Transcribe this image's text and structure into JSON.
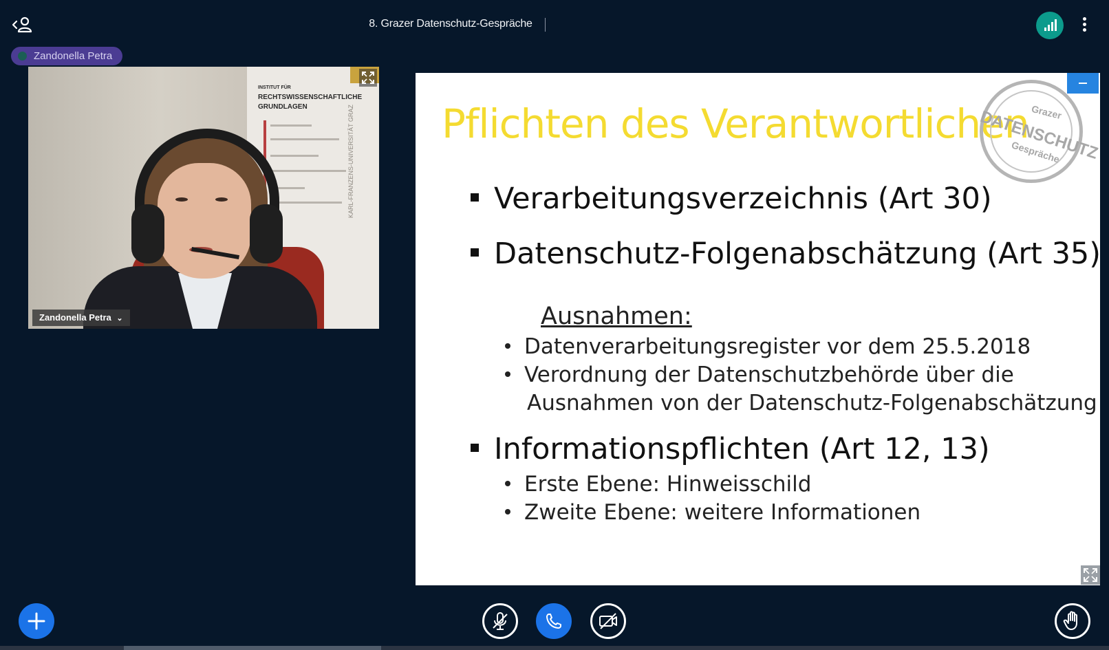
{
  "header": {
    "title": "8. Grazer Datenschutz-Gespräche",
    "users_icon": "user-list-toggle-icon",
    "connection_icon": "connection-status-icon",
    "options_icon": "options-kebab-icon"
  },
  "talking_indicator": {
    "name": "Zandonella Petra"
  },
  "webcam": {
    "user_name": "Zandonella Petra",
    "name_caret": "⌄",
    "poster": {
      "line1": "INSTITUT FÜR",
      "line2": "RECHTSWISSENSCHAFTLICHE",
      "line3": "GRUNDLAGEN",
      "vertical": "KARL-FRANZENS-UNIVERSITÄT GRAZ"
    }
  },
  "slide": {
    "title": "Pflichten des Verantwortlichen",
    "stamp": {
      "top": "Grazer",
      "middle": "DATENSCHUTZ",
      "bottom": "Gespräche"
    },
    "bullets": [
      "Verarbeitungsverzeichnis (Art 30)",
      "Datenschutz-Folgenabschätzung (Art 35)",
      "Informationspflichten (Art 12, 13)"
    ],
    "exceptions_heading": "Ausnahmen:",
    "exceptions": [
      "Datenverarbeitungsregister vor dem 25.5.2018",
      "Verordnung der Datenschutzbehörde über die",
      "Ausnahmen von der Datenschutz-Folgenabschätzung"
    ],
    "info_items": [
      "Erste Ebene: Hinweisschild",
      "Zweite Ebene: weitere Informationen"
    ]
  },
  "controls": {
    "add_icon": "plus-icon",
    "audio_icon": "microphone-muted-icon",
    "phone_icon": "phone-icon",
    "video_icon": "camera-off-icon",
    "hand_icon": "raise-hand-icon"
  },
  "colors": {
    "background": "#06172a",
    "accent_blue": "#1b73e8",
    "connection_green": "#0c9b8c",
    "talker_purple": "#4b3c93",
    "slide_title_yellow": "#f4db31"
  }
}
